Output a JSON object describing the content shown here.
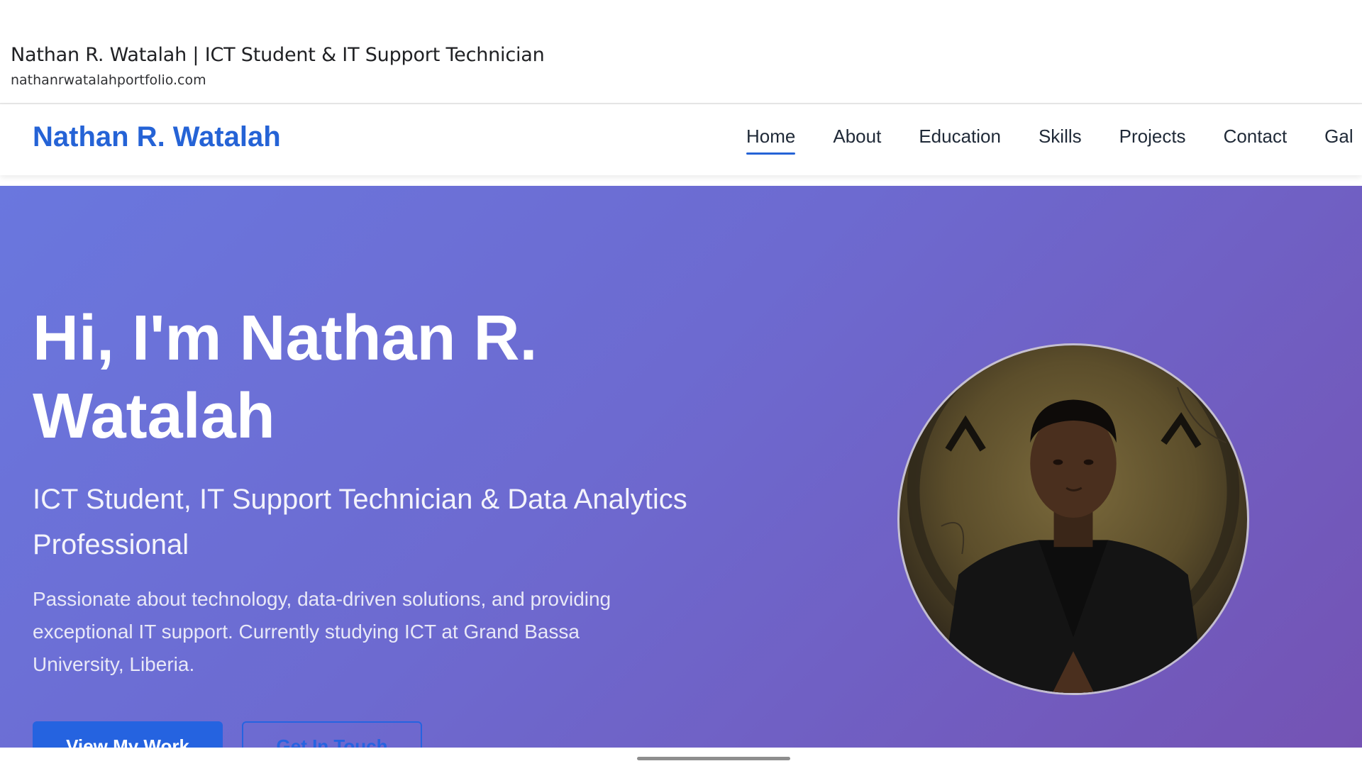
{
  "browser": {
    "page_title": "Nathan R. Watalah | ICT Student & IT Support Technician",
    "url": "nathanrwatalahportfolio.com"
  },
  "nav": {
    "brand": "Nathan R. Watalah",
    "links": [
      "Home",
      "About",
      "Education",
      "Skills",
      "Projects",
      "Contact",
      "Gal"
    ],
    "active": "Home"
  },
  "hero": {
    "title": "Hi, I'm Nathan R. Watalah",
    "subtitle": "ICT Student, IT Support Technician & Data Analytics Professional",
    "description": "Passionate about technology, data-driven solutions, and providing exceptional IT support. Currently studying ICT at Grand Bassa University, Liberia.",
    "primary_button": "View My Work",
    "secondary_button": "Get In Touch"
  },
  "colors": {
    "accent": "#2563d6",
    "hero_gradient_start": "#6a77de",
    "hero_gradient_end": "#7453b4"
  }
}
